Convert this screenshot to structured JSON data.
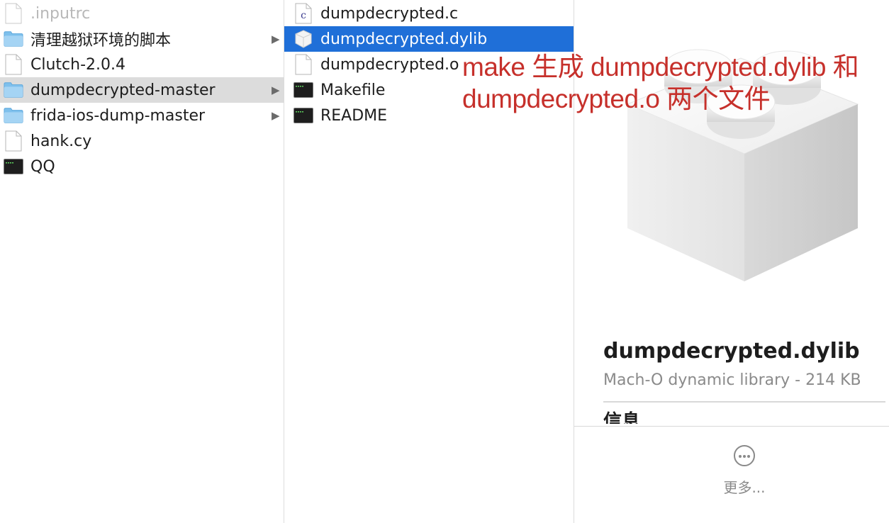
{
  "column1": {
    "items": [
      {
        "label": ".inputrc",
        "icon": "document-icon",
        "dimmed": true
      },
      {
        "label": "清理越狱环境的脚本",
        "icon": "folder-icon",
        "has_children": true
      },
      {
        "label": "Clutch-2.0.4",
        "icon": "document-icon"
      },
      {
        "label": "dumpdecrypted-master",
        "icon": "folder-icon",
        "has_children": true,
        "selected": true
      },
      {
        "label": "frida-ios-dump-master",
        "icon": "folder-icon",
        "has_children": true
      },
      {
        "label": "hank.cy",
        "icon": "document-icon"
      },
      {
        "label": "QQ",
        "icon": "terminal-exec-icon"
      }
    ]
  },
  "column2": {
    "items": [
      {
        "label": "dumpdecrypted.c",
        "icon": "c-source-icon"
      },
      {
        "label": "dumpdecrypted.dylib",
        "icon": "dylib-icon",
        "selected": true
      },
      {
        "label": "dumpdecrypted.o",
        "icon": "document-icon"
      },
      {
        "label": "Makefile",
        "icon": "terminal-exec-icon"
      },
      {
        "label": "README",
        "icon": "terminal-exec-icon"
      }
    ]
  },
  "preview": {
    "icon": "library-lego-brick-icon",
    "title": "dumpdecrypted.dylib",
    "subtitle": "Mach-O dynamic library - 214 KB",
    "section_heading": "信息",
    "more_label": "更多..."
  },
  "annotation": {
    "line1": "make 生成 dumpdecrypted.dylib 和",
    "line2": "dumpdecrypted.o 两个文件"
  },
  "colors": {
    "selection_blue": "#1f6fd8",
    "selection_gray": "#dcdcdc",
    "folder_blue": "#7ec0ec",
    "annotation_red": "#c6302b"
  }
}
